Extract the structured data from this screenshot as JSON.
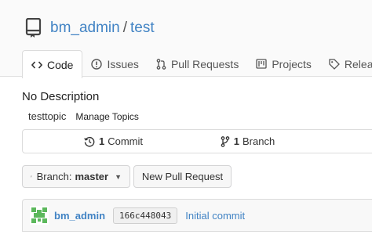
{
  "repo": {
    "owner": "bm_admin",
    "separator": "/",
    "name": "test"
  },
  "tabs": [
    {
      "label": "Code",
      "icon": "code-icon",
      "active": true
    },
    {
      "label": "Issues",
      "icon": "issue-icon"
    },
    {
      "label": "Pull Requests",
      "icon": "pull-request-icon"
    },
    {
      "label": "Projects",
      "icon": "project-icon"
    },
    {
      "label": "Releases",
      "icon": "tag-icon"
    }
  ],
  "description": "No Description",
  "topics": {
    "items": [
      "testtopic"
    ],
    "manage_label": "Manage Topics"
  },
  "stats": {
    "commits_count": "1",
    "commits_label": "Commit",
    "branches_count": "1",
    "branches_label": "Branch"
  },
  "branch_selector": {
    "prefix": "Branch:",
    "value": "master"
  },
  "new_pr_label": "New Pull Request",
  "latest_commit": {
    "author": "bm_admin",
    "sha": "166c448043",
    "message": "Initial commit"
  },
  "colors": {
    "link": "#4183c4",
    "header_bg": "#fafafa",
    "border": "#dcdcdc",
    "avatar": "#5cb85c"
  }
}
